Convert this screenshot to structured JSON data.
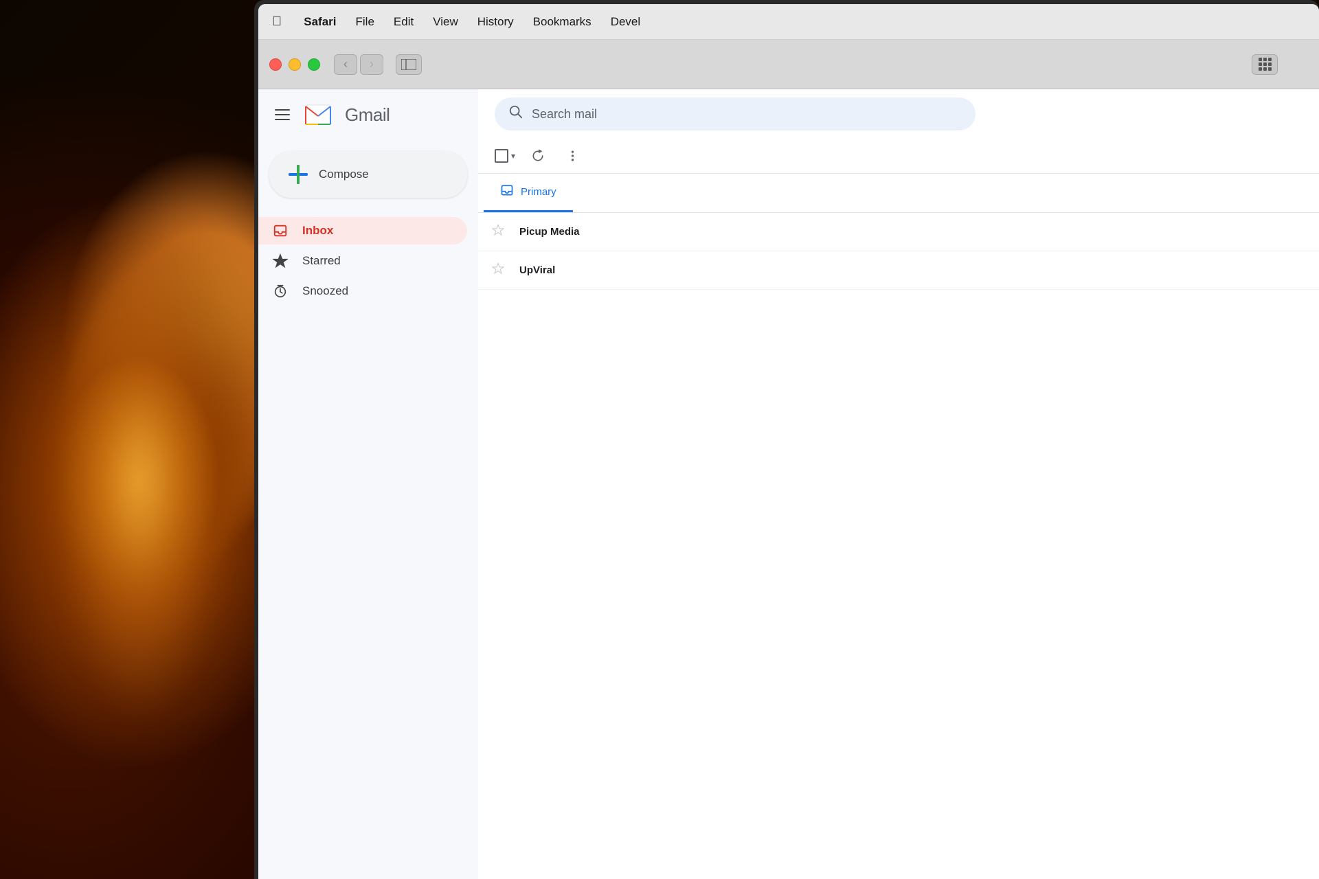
{
  "background": {
    "description": "Dark warm bokeh background with glowing light bulbs"
  },
  "macos_menubar": {
    "apple_icon": "",
    "items": [
      {
        "label": "Safari",
        "bold": true
      },
      {
        "label": "File"
      },
      {
        "label": "Edit"
      },
      {
        "label": "View"
      },
      {
        "label": "History"
      },
      {
        "label": "Bookmarks"
      },
      {
        "label": "Devel"
      }
    ]
  },
  "browser_chrome": {
    "back_button": "‹",
    "forward_button": "›",
    "sidebar_toggle": "sidebar",
    "grid_button": "grid"
  },
  "gmail": {
    "header": {
      "menu_icon": "≡",
      "logo_text": "Gmail"
    },
    "compose_button": {
      "label": "Compose"
    },
    "sidebar_items": [
      {
        "id": "inbox",
        "label": "Inbox",
        "icon": "inbox",
        "active": true
      },
      {
        "id": "starred",
        "label": "Starred",
        "icon": "star",
        "active": false
      },
      {
        "id": "snoozed",
        "label": "Snoozed",
        "icon": "snoozed",
        "active": false
      }
    ],
    "search": {
      "placeholder": "Search mail"
    },
    "toolbar": {
      "checkbox_label": "select",
      "refresh_label": "refresh",
      "more_label": "more"
    },
    "tabs": [
      {
        "id": "primary",
        "label": "Primary",
        "icon": "inbox",
        "active": true
      }
    ],
    "email_list": [
      {
        "sender": "Picup Media",
        "starred": false
      },
      {
        "sender": "UpViral",
        "starred": false
      }
    ]
  }
}
